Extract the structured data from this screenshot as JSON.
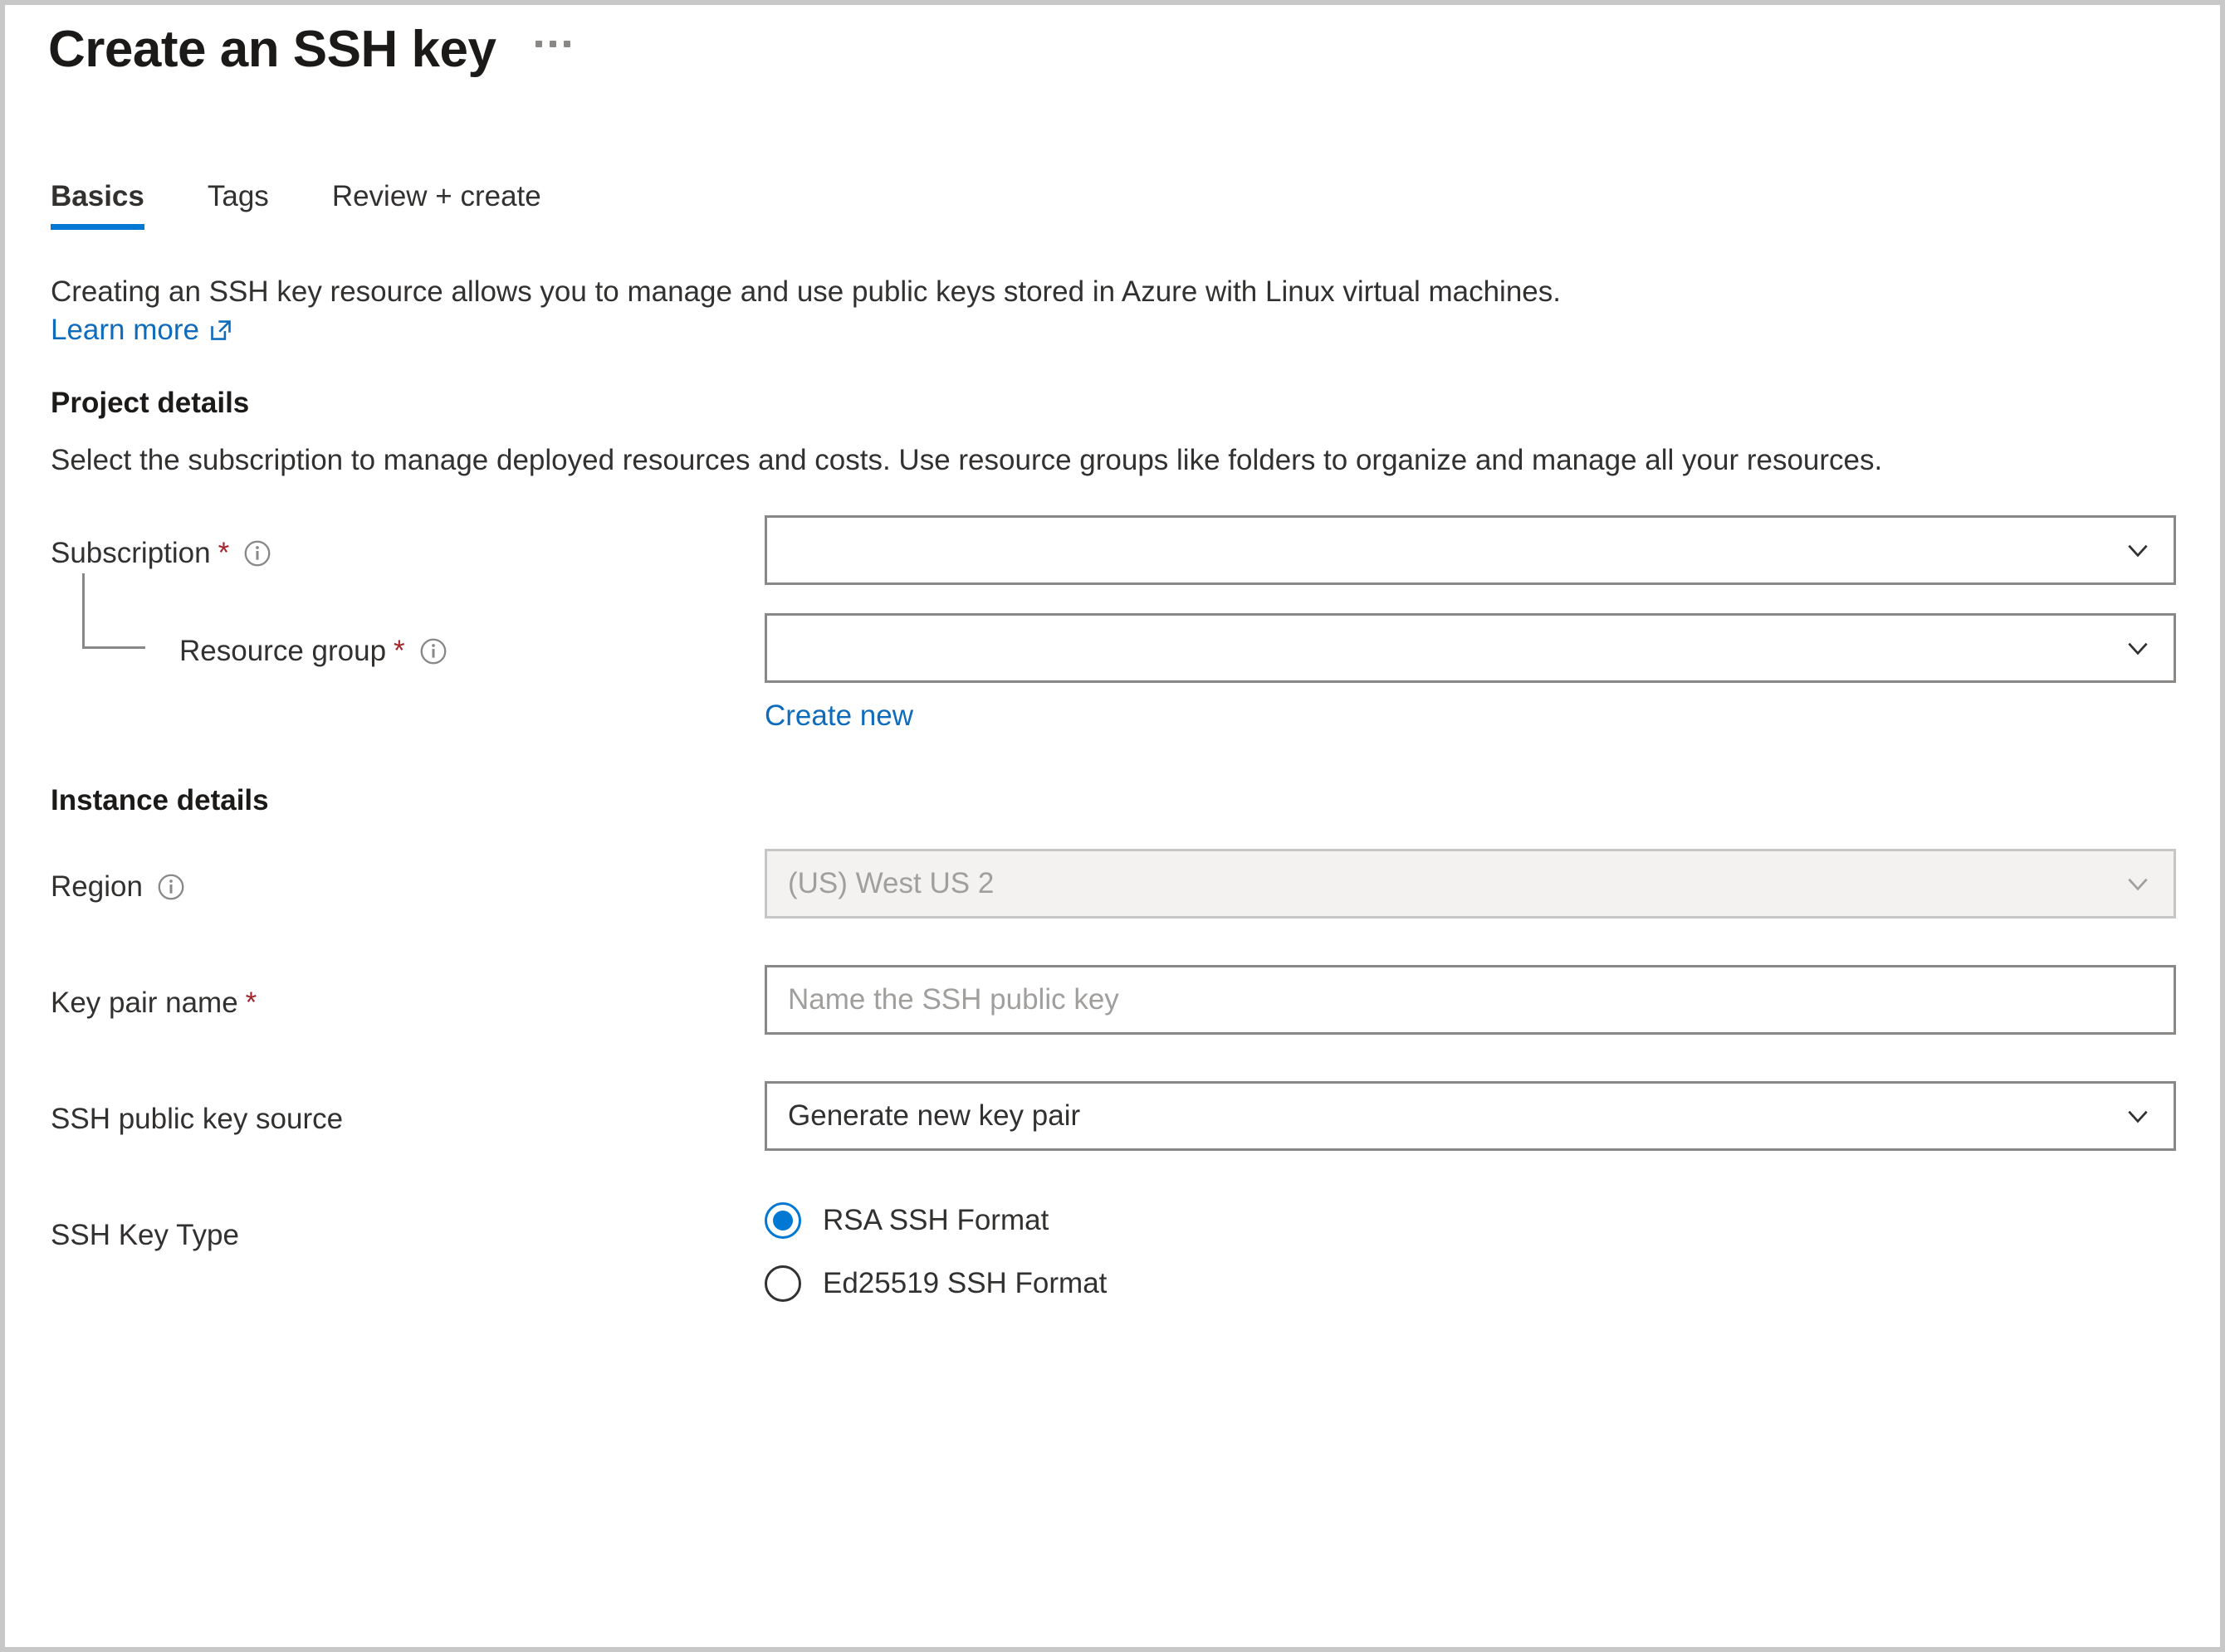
{
  "page": {
    "title": "Create an SSH key",
    "more_menu": "…"
  },
  "tabs": [
    {
      "label": "Basics",
      "active": true
    },
    {
      "label": "Tags",
      "active": false
    },
    {
      "label": "Review + create",
      "active": false
    }
  ],
  "intro": {
    "text": "Creating an SSH key resource allows you to manage and use public keys stored in Azure with Linux virtual machines.",
    "learn_more": "Learn more"
  },
  "project_details": {
    "heading": "Project details",
    "description": "Select the subscription to manage deployed resources and costs. Use resource groups like folders to organize and manage all your resources.",
    "subscription": {
      "label": "Subscription",
      "required": "*",
      "value": "",
      "placeholder": ""
    },
    "resource_group": {
      "label": "Resource group",
      "required": "*",
      "value": "",
      "placeholder": "",
      "create_new": "Create new"
    }
  },
  "instance_details": {
    "heading": "Instance details",
    "region": {
      "label": "Region",
      "value": "(US) West US 2",
      "disabled": true
    },
    "key_pair_name": {
      "label": "Key pair name",
      "required": "*",
      "value": "",
      "placeholder": "Name the SSH public key"
    },
    "ssh_public_key_source": {
      "label": "SSH public key source",
      "value": "Generate new key pair"
    },
    "ssh_key_type": {
      "label": "SSH Key Type",
      "options": [
        {
          "label": "RSA SSH Format",
          "selected": true
        },
        {
          "label": "Ed25519 SSH Format",
          "selected": false
        }
      ]
    }
  },
  "colors": {
    "accent": "#0078d4",
    "link": "#0f6cbd",
    "required": "#a4262c",
    "border": "#8a8886",
    "disabled_bg": "#f3f2f1",
    "text": "#323130"
  }
}
